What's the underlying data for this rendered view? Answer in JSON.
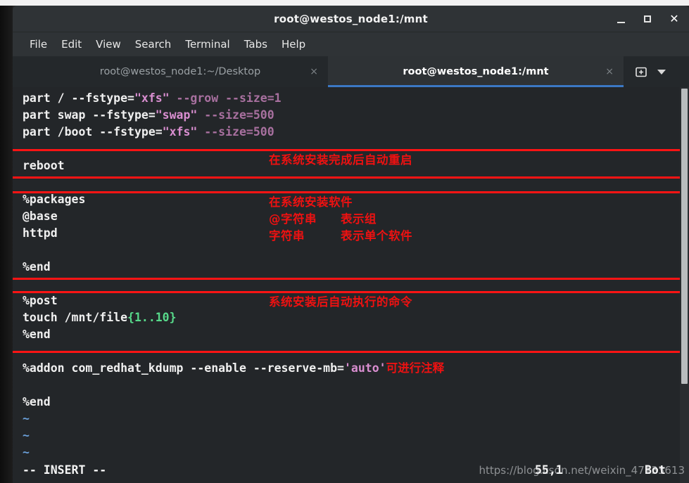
{
  "window": {
    "title": "root@westos_node1:/mnt",
    "controls": {
      "minimize": "_",
      "maximize": "□",
      "close": "✕"
    }
  },
  "menubar": {
    "items": [
      {
        "label": "File"
      },
      {
        "label": "Edit"
      },
      {
        "label": "View"
      },
      {
        "label": "Search"
      },
      {
        "label": "Terminal"
      },
      {
        "label": "Tabs"
      },
      {
        "label": "Help"
      }
    ]
  },
  "tabbar": {
    "tabs": [
      {
        "label": "root@westos_node1:~/Desktop",
        "close": "×",
        "active": false
      },
      {
        "label": "root@westos_node1:/mnt",
        "close": "×",
        "active": true
      }
    ],
    "new_tab_icon": "new-tab-icon",
    "dropdown_icon": "chevron-down-icon"
  },
  "terminal": {
    "lines": {
      "part_root": {
        "cmd": "part / ",
        "opt1": "--fstype=",
        "str1": "\"xfs\"",
        "opt2": " --grow --size=1"
      },
      "part_swap": {
        "cmd": "part swap ",
        "opt1": "--fstype=",
        "str1": "\"swap\"",
        "opt2": " --size=500"
      },
      "part_boot": {
        "cmd": "part /boot ",
        "opt1": "--fstype=",
        "str1": "\"xfs\"",
        "opt2": " --size=500"
      },
      "reboot": "reboot",
      "packages": "%packages",
      "base": "@base",
      "httpd": "httpd",
      "packages_end": "%end",
      "post": "%post",
      "touch_cmd": "touch /mnt/file",
      "touch_brace": "{1..10}",
      "post_end": "%end",
      "addon": "%addon com_redhat_kdump --enable --reserve-mb=",
      "addon_str": "'auto'",
      "addon_annotation": "可进行注释",
      "addon_end": "%end",
      "tilde": "~"
    },
    "annotations": {
      "reboot": "在系统安装完成后自动重启",
      "packages_1": "在系统安装软件",
      "packages_2": "@字符串　　表示组",
      "packages_3": "字符串　　　表示单个软件",
      "post": "系统安装后自动执行的命令"
    },
    "statusline": {
      "mode": "-- INSERT --",
      "position": "55,1",
      "location": "Bot"
    }
  },
  "watermark": "https://blog.csdn.net/weixin_47133613",
  "colors": {
    "accent_tab": "#3b78c4",
    "annotation_red": "#ee1111",
    "box_red": "#ff1414",
    "string_pink": "#d98ed0",
    "option_mauve": "#a8709f",
    "brace_green": "#57d98a",
    "tilde_blue": "#6a9fd8",
    "terminal_bg": "#232629"
  }
}
